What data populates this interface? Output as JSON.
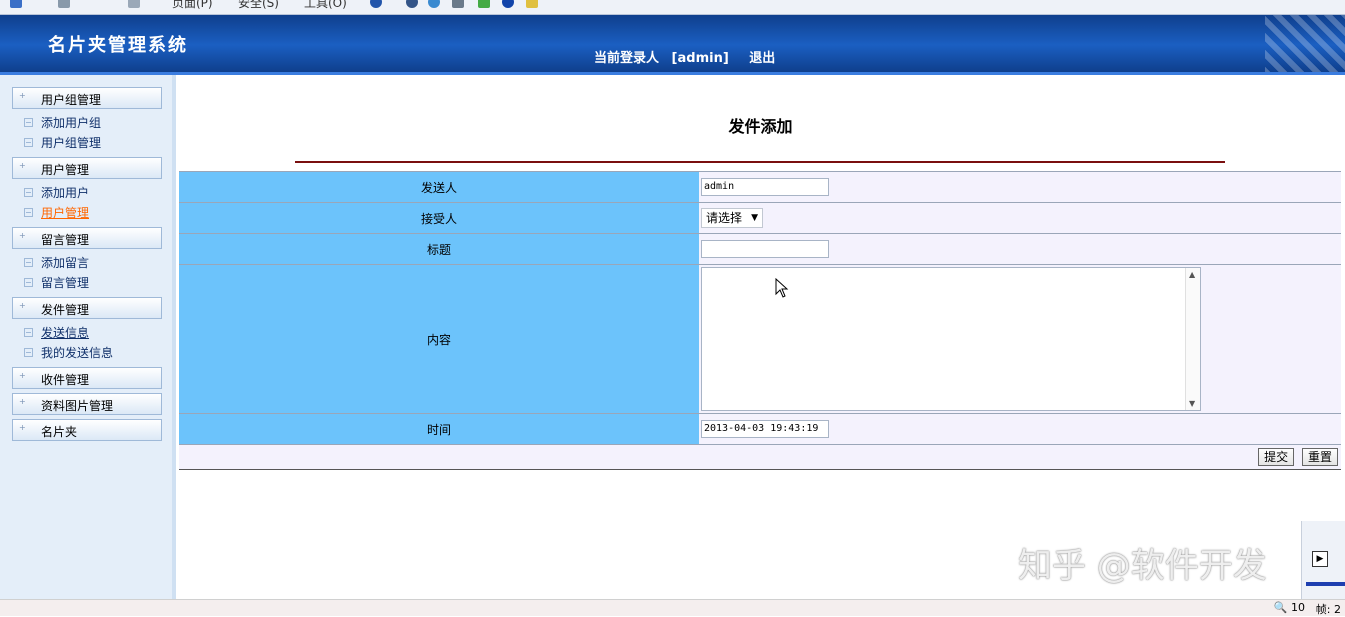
{
  "ie_toolbar": {
    "page_menu": "页面(P)",
    "safety_menu": "安全(S)",
    "tools_menu": "工具(O)"
  },
  "header": {
    "app_title": "名片夹管理系统",
    "login_label": "当前登录人",
    "login_user": "[admin]",
    "logout_label": "退出"
  },
  "sidebar": {
    "groups": [
      {
        "label": "用户组管理"
      },
      {
        "label": "用户管理"
      },
      {
        "label": "留言管理"
      },
      {
        "label": "发件管理"
      },
      {
        "label": "收件管理"
      },
      {
        "label": "资料图片管理"
      },
      {
        "label": "名片夹"
      }
    ],
    "items": [
      {
        "label": "添加用户组"
      },
      {
        "label": "用户组管理"
      },
      {
        "label": "添加用户"
      },
      {
        "label": "用户管理"
      },
      {
        "label": "添加留言"
      },
      {
        "label": "留言管理"
      },
      {
        "label": "发送信息"
      },
      {
        "label": "我的发送信息"
      }
    ]
  },
  "main": {
    "page_title": "发件添加",
    "form": {
      "sender_label": "发送人",
      "sender_value": "admin",
      "receiver_label": "接受人",
      "receiver_value": "请选择",
      "subject_label": "标题",
      "subject_value": "",
      "content_label": "内容",
      "time_label": "时间",
      "time_value": "2013-04-03 19:43:19",
      "submit_label": "提交",
      "reset_label": "重置"
    }
  },
  "watermark": "知乎 @软件开发",
  "status": {
    "zoom": "10",
    "frame": "帧: 2"
  },
  "colors": {
    "header": "#1b5fc2",
    "label_cell": "#6cc3fb",
    "field_cell": "#f4f2fd",
    "rule": "#7a0f0f",
    "active_link": "#ff6600"
  }
}
